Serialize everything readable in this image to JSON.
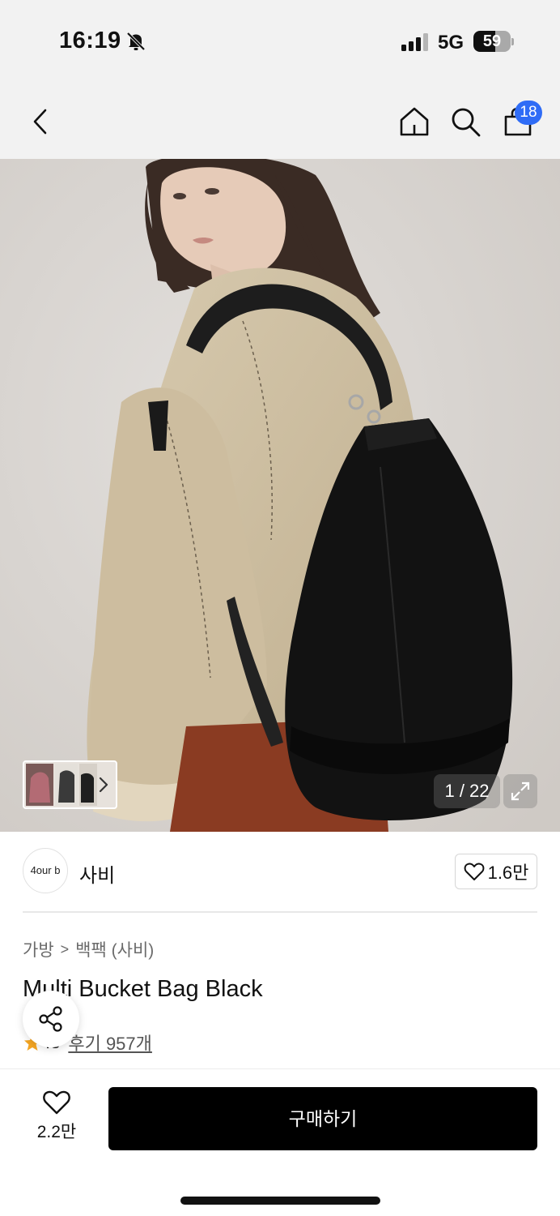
{
  "status_bar": {
    "time": "16:19",
    "network": "5G",
    "battery_percent": "59",
    "battery_level": 0.59,
    "icons": [
      "bell-off-icon",
      "signal-icon",
      "battery-icon"
    ]
  },
  "nav": {
    "icons": [
      "back-chevron-icon",
      "home-icon",
      "search-icon",
      "shopping-bag-icon"
    ],
    "cart_count": "18",
    "badge_color": "#2f6cf6"
  },
  "gallery": {
    "counter": "1 / 22",
    "icons": [
      "chevron-right-icon",
      "expand-icon"
    ]
  },
  "brand": {
    "logo_text": "4our b",
    "name": "사비",
    "like_count": "1.6만"
  },
  "product": {
    "breadcrumb": [
      "가방",
      "백팩 (사비)"
    ],
    "title": "Multi Bucket Bag Black",
    "rating": ".8",
    "reviews": "후기 957개",
    "star_color": "#f5a623"
  },
  "actions": {
    "wish_count": "2.2만",
    "buy_label": "구매하기",
    "icons": [
      "share-icon",
      "heart-icon"
    ]
  }
}
